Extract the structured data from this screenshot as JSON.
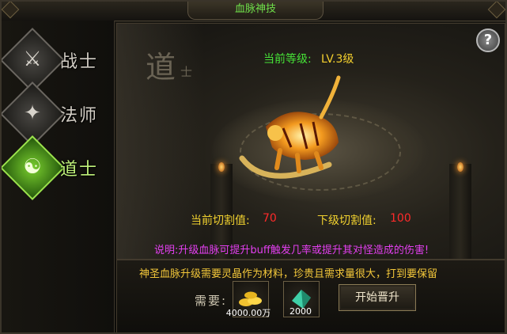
{
  "window": {
    "title": "血脉神技"
  },
  "nav": {
    "tabs": [
      {
        "label": "战士",
        "icon": "warrior-emblem-icon",
        "active": false
      },
      {
        "label": "法师",
        "icon": "mage-emblem-icon",
        "active": false
      },
      {
        "label": "道士",
        "icon": "taoist-emblem-icon",
        "active": true
      }
    ]
  },
  "main": {
    "help_label": "?",
    "background_glyph": "道",
    "background_glyph_small": "士",
    "level_label": "当前等级:",
    "level_value": "LV.3级",
    "current_cut_label": "当前切割值:",
    "current_cut_value": "70",
    "next_cut_label": "下级切割值:",
    "next_cut_value": "100",
    "description": "说明:升级血脉可提升buff触发几率或提升其对怪造成的伤害!"
  },
  "bottom": {
    "info": "神圣血脉升级需要灵晶作为材料，珍贵且需求量很大，打到要保留",
    "need_label": "需要:",
    "costs": [
      {
        "icon": "gold-ingot-icon",
        "amount": "4000.00万"
      },
      {
        "icon": "spirit-crystal-icon",
        "amount": "2000"
      }
    ],
    "start_button": "开始晋升"
  },
  "colors": {
    "title": "#6fe04a",
    "level_label": "#46e337",
    "level_value": "#f4cf2e",
    "cut_label": "#f1d12f",
    "cut_value": "#ff2a2a",
    "description": "#e33ff0",
    "info": "#f3c73a",
    "active_tab": "#9be34c"
  }
}
